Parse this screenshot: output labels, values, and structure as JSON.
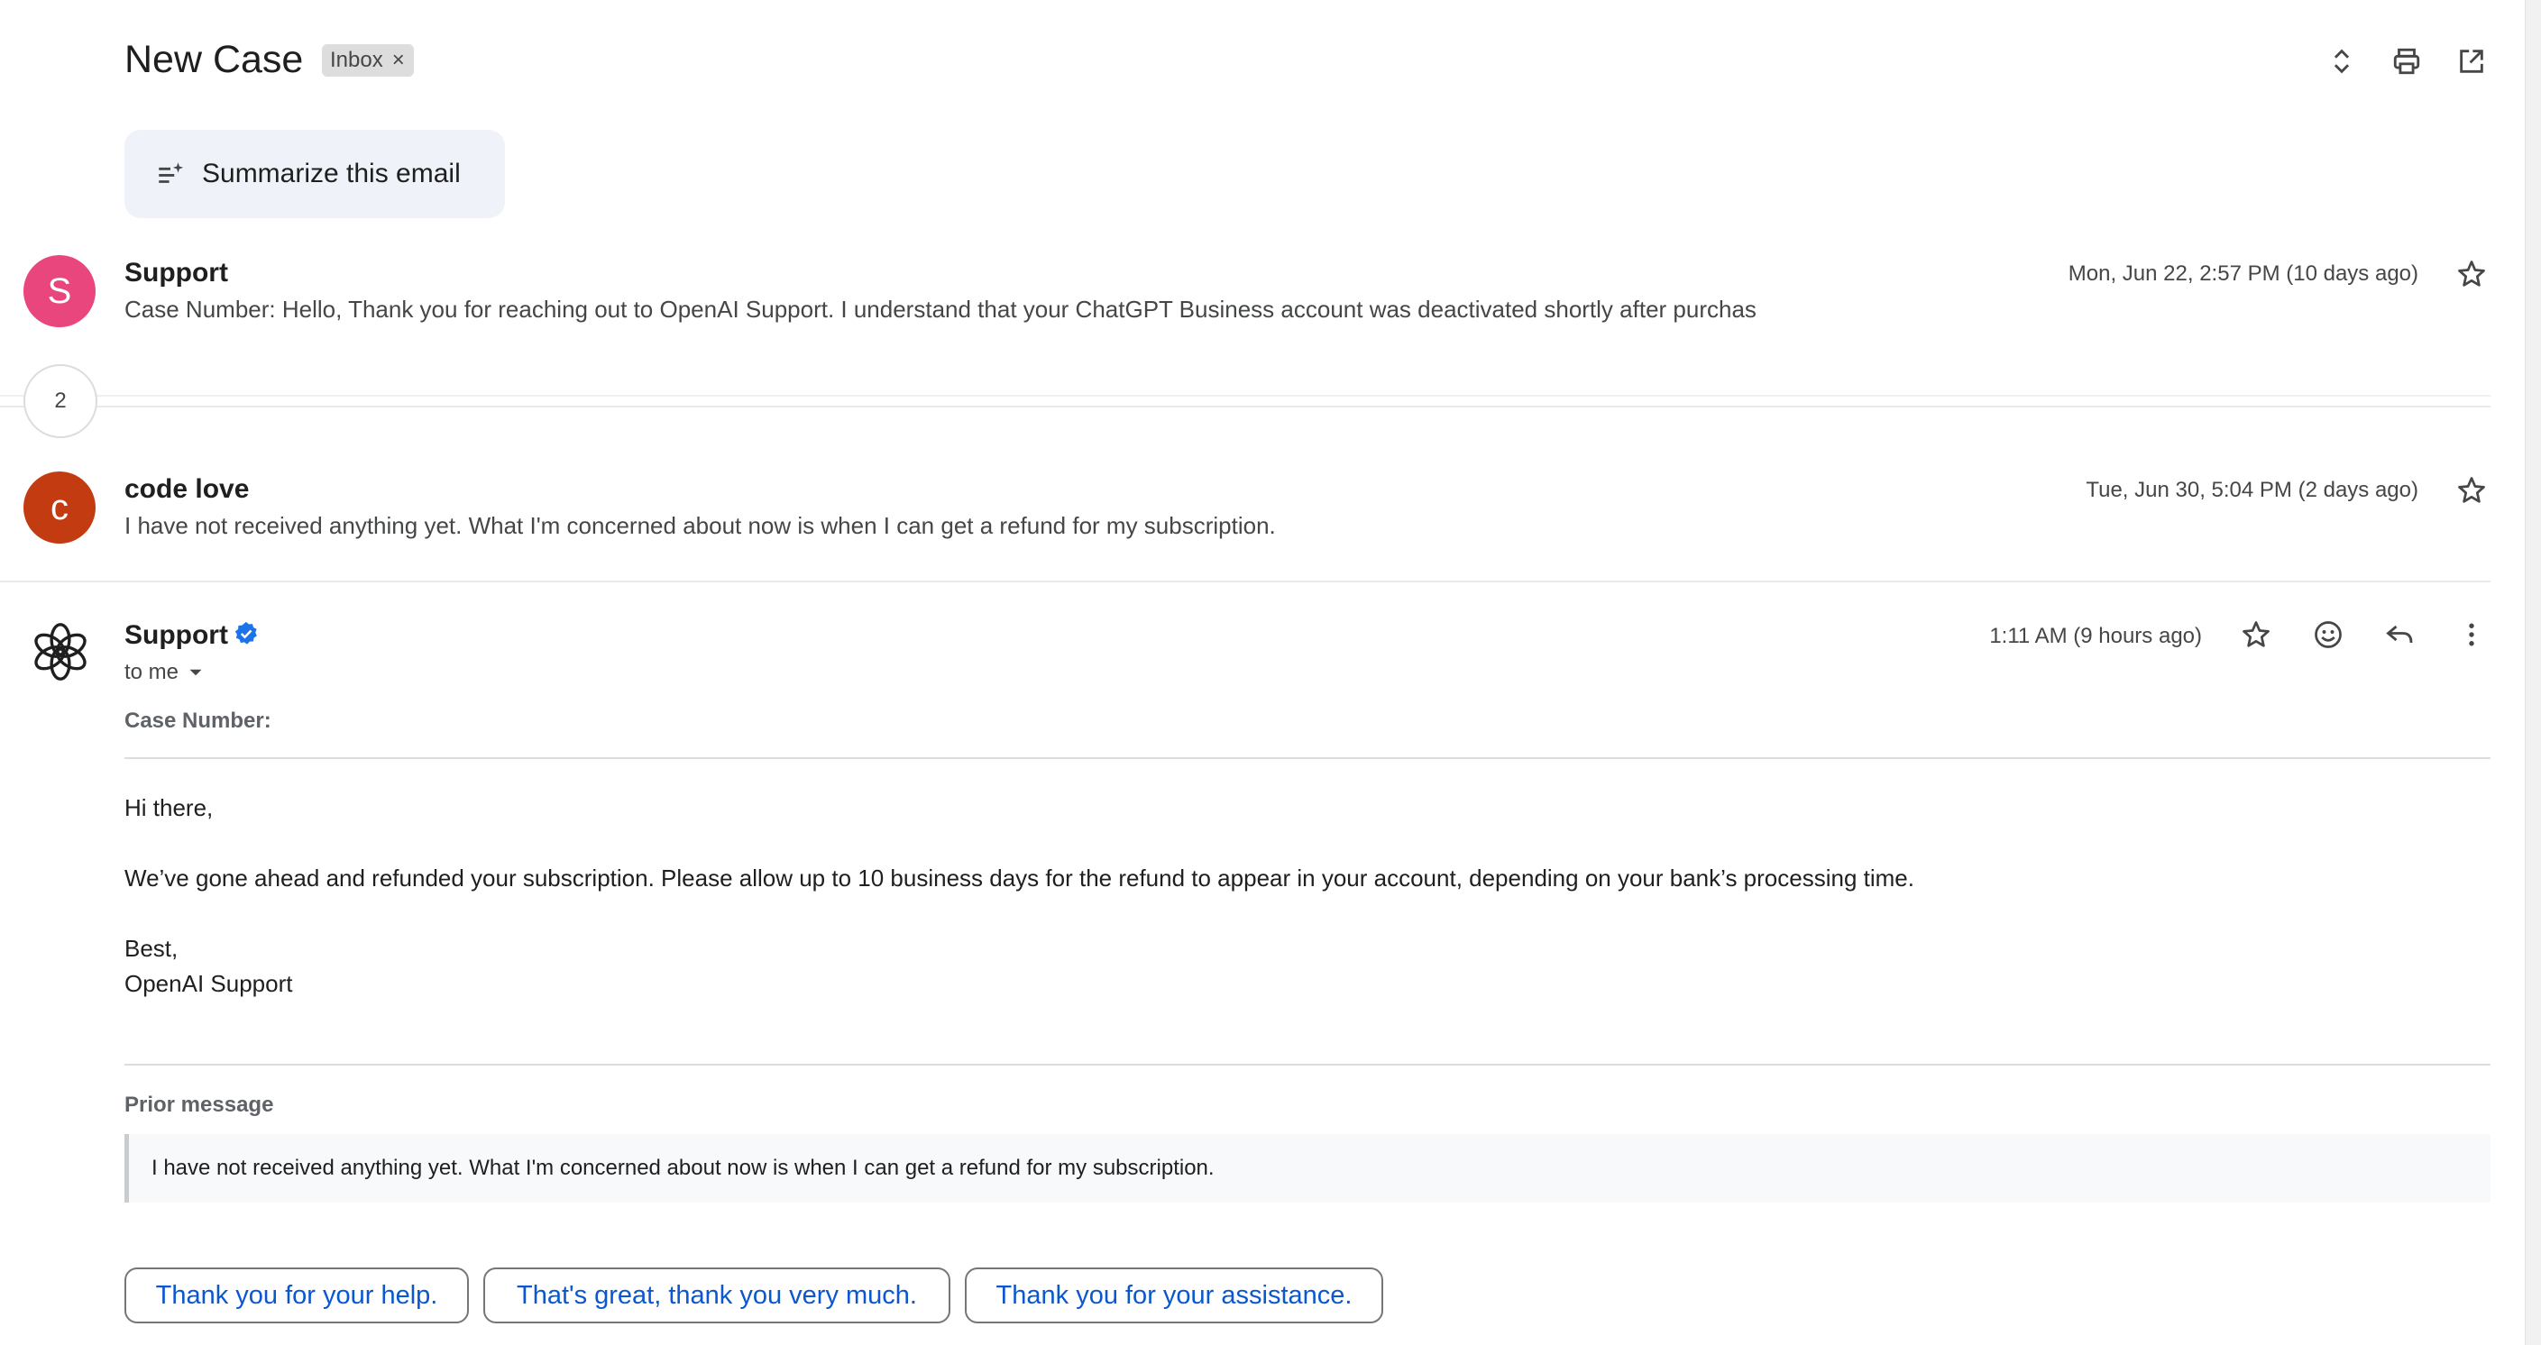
{
  "header": {
    "subject": "New Case",
    "label": "Inbox",
    "label_remove": "×"
  },
  "summarize": {
    "label": "Summarize this email"
  },
  "messages": [
    {
      "sender": "Support",
      "avatar_letter": "S",
      "avatar_color": "#e8467c",
      "date": "Mon, Jun 22, 2:57 PM (10 days ago)",
      "snippet": "Case Number: Hello, Thank you for reaching out to OpenAI Support. I understand that your ChatGPT Business account was deactivated shortly after purchas"
    },
    {
      "sender": "code love",
      "avatar_letter": "c",
      "avatar_color": "#c23b11",
      "date": "Tue, Jun 30, 5:04 PM (2 days ago)",
      "snippet": "I have not received anything yet. What I'm concerned about now is when I can get a refund for my subscription."
    }
  ],
  "collapsed_count": "2",
  "open_message": {
    "sender": "Support",
    "recipient": "to me",
    "date": "1:11 AM (9 hours ago)",
    "case_label": "Case Number:",
    "greeting": "Hi there,",
    "body": "We’ve gone ahead and refunded your subscription. Please allow up to 10 business days for the refund to appear in your account, depending on your bank’s processing time.",
    "signoff": "Best,",
    "signature": "OpenAI Support",
    "prior_label": "Prior message",
    "prior_text": "I have not received anything yet. What I'm concerned about now is when I can get a refund for my subscription."
  },
  "smart_replies": [
    "Thank you for your help.",
    "That's great, thank you very much.",
    "Thank you for your assistance."
  ],
  "colors": {
    "accent_blue": "#0b57d0",
    "verified_blue": "#1a73e8"
  }
}
